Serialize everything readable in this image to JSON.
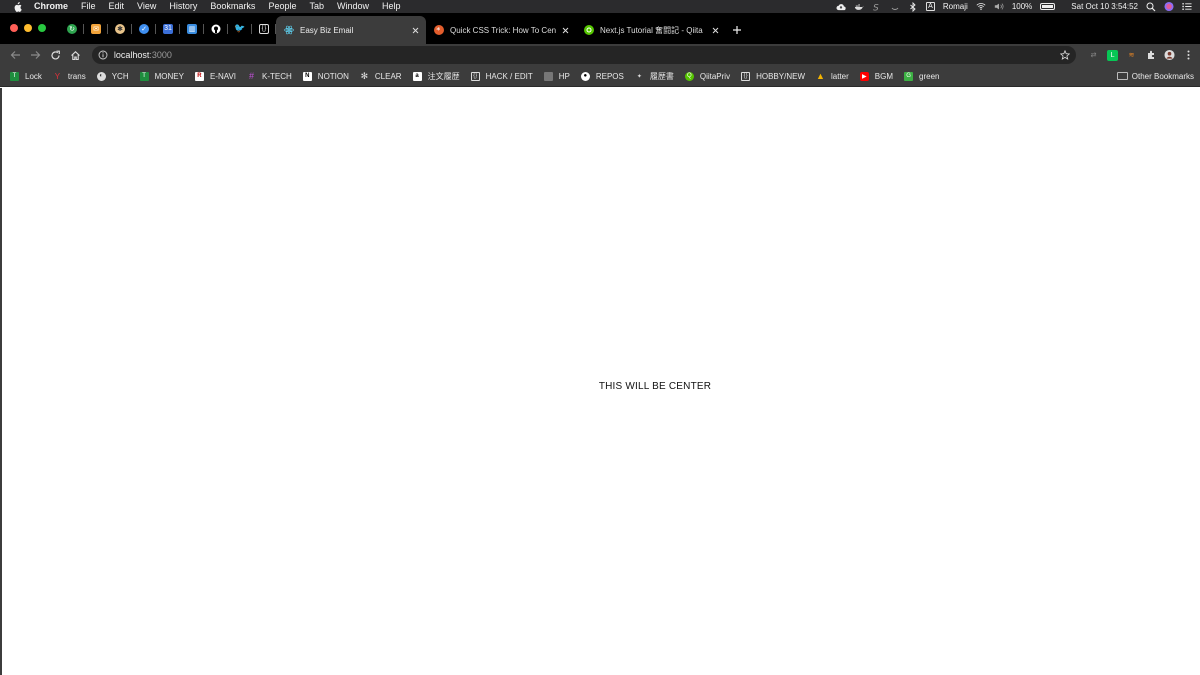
{
  "menubar": {
    "app_name": "Chrome",
    "items": [
      "File",
      "Edit",
      "View",
      "History",
      "Bookmarks",
      "People",
      "Tab",
      "Window",
      "Help"
    ],
    "input_source": "Romaji",
    "battery": "100%",
    "datetime": "Sat Oct 10  3:54:52"
  },
  "tabs": {
    "active_title": "Easy Biz Email",
    "tab2_title": "Quick CSS Trick: How To Cente",
    "tab3_title": "Next.js Tutorial 奮闘記 - Qiita"
  },
  "toolbar": {
    "url_host": "localhost",
    "url_port": ":3000"
  },
  "bookmarks": {
    "items": [
      "Lock",
      "trans",
      "YCH",
      "MONEY",
      "E-NAVI",
      "K-TECH",
      "NOTION",
      "CLEAR",
      "注文履歴",
      "HACK / EDIT",
      "HP",
      "REPOS",
      "履歴書",
      "QiitaPriv",
      "HOBBY/NEW",
      "latter",
      "BGM",
      "green"
    ],
    "other": "Other Bookmarks"
  },
  "page": {
    "text": "THIS WILL BE CENTER"
  },
  "colors": {
    "menubar_bg": "#2b2b2d",
    "tabstrip_bg": "#000000",
    "toolbar_bg": "#3c3c3c",
    "omnibox_bg": "#252525",
    "page_bg": "#ffffff"
  }
}
